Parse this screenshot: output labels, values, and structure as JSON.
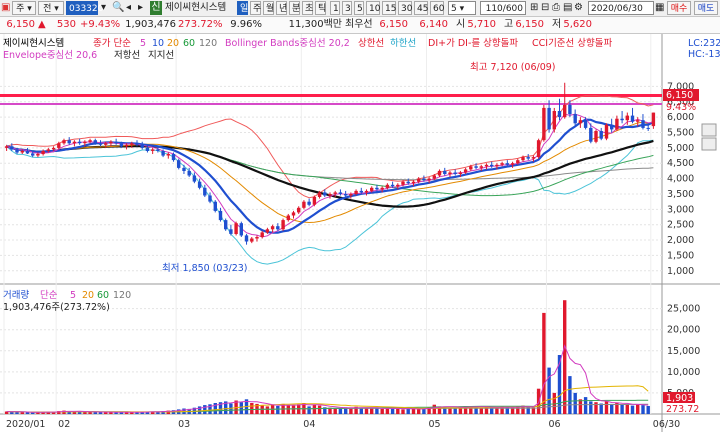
{
  "toolbar": {
    "market_label": "주",
    "market_suffix": "전",
    "code_value": "033320",
    "badge": "신",
    "company_name": "제이씨현시스템",
    "period_tabs": [
      "일",
      "주",
      "월",
      "년",
      "분",
      "초",
      "틱"
    ],
    "selected_period_index": 0,
    "minute_buttons": [
      "1",
      "3",
      "5",
      "10",
      "15",
      "30",
      "45",
      "60"
    ],
    "interval_value": "5",
    "count_value": "110/600",
    "date_value": "2020/06/30",
    "buy_label": "매수",
    "sell_label": "매도"
  },
  "quote": {
    "price": "6,150",
    "change": "530",
    "change_pct": "+9.43%",
    "volume": "1,903,476",
    "volume_ratio": "273.72%",
    "turnover": "9.96%",
    "value": "11,300백만",
    "best_ask_label": "최우선",
    "best_ask": "6,150",
    "best_bid": "6,140",
    "open_label": "시",
    "open": "5,710",
    "high_label": "고",
    "high": "6,150",
    "low_label": "저",
    "low": "5,620"
  },
  "indicators": {
    "name": "제이씨현시스템",
    "ma_label": "종가 단순",
    "ma_periods": [
      "5",
      "10",
      "20",
      "60",
      "120"
    ],
    "bb_label": "Bollinger Bands중심선 20,2",
    "bb_upper": "상한선",
    "bb_lower": "하한선",
    "dmi_label": "DI+가 DI-를 상향돌파",
    "cci_label": "CCI기준선 상향돌파",
    "env_label": "Envelope중심선 20,6",
    "resist_label": "저항선",
    "support_label": "지지선",
    "lc_label": "LC:232",
    "hc_label": "HC:-13"
  },
  "annotations": {
    "high": "최고 7,120 (06/09)",
    "low": "최저 1,850 (03/23)",
    "last_price": "6,150",
    "last_pct": "9.43%"
  },
  "volume_panel": {
    "title": "거래량",
    "ma_label": "단순",
    "ma_periods": [
      "5",
      "20",
      "60",
      "120"
    ],
    "current": "1,903,476주(273.72%)",
    "last_box": "1,903",
    "last_pct": "273.72"
  },
  "chart_data": {
    "type": "candlestick",
    "price_axis": {
      "ticks": [
        "7,000",
        "6,500",
        "6,000",
        "5,500",
        "5,000",
        "4,500",
        "4,000",
        "3,500",
        "3,000",
        "2,500",
        "2,000",
        "1,500",
        "1,000"
      ],
      "range": [
        700,
        7600
      ]
    },
    "volume_axis": {
      "ticks": [
        "25,000",
        "20,000",
        "15,000",
        "10,000",
        "5,000"
      ],
      "range": [
        0,
        28000
      ],
      "unit": "천주"
    },
    "x_labels": [
      "2020/01",
      "02",
      "03",
      "04",
      "05",
      "06",
      "06/30"
    ],
    "x_label_positions": [
      0,
      10,
      33,
      57,
      81,
      104,
      124
    ],
    "candles": [
      {
        "o": 5000,
        "h": 5100,
        "l": 4900,
        "c": 5050
      },
      {
        "o": 5050,
        "h": 5150,
        "l": 4900,
        "c": 4950
      },
      {
        "o": 4950,
        "h": 5000,
        "l": 4800,
        "c": 4850
      },
      {
        "o": 4850,
        "h": 4950,
        "l": 4800,
        "c": 4900
      },
      {
        "o": 4900,
        "h": 5000,
        "l": 4800,
        "c": 4820
      },
      {
        "o": 4820,
        "h": 4900,
        "l": 4700,
        "c": 4750
      },
      {
        "o": 4750,
        "h": 4850,
        "l": 4700,
        "c": 4800
      },
      {
        "o": 4800,
        "h": 4950,
        "l": 4750,
        "c": 4900
      },
      {
        "o": 4900,
        "h": 5000,
        "l": 4850,
        "c": 4950
      },
      {
        "o": 4950,
        "h": 5050,
        "l": 4900,
        "c": 5000
      },
      {
        "o": 5000,
        "h": 5200,
        "l": 4950,
        "c": 5150
      },
      {
        "o": 5150,
        "h": 5300,
        "l": 5100,
        "c": 5250
      },
      {
        "o": 5250,
        "h": 5350,
        "l": 5100,
        "c": 5150
      },
      {
        "o": 5150,
        "h": 5250,
        "l": 5050,
        "c": 5200
      },
      {
        "o": 5200,
        "h": 5300,
        "l": 5100,
        "c": 5150
      },
      {
        "o": 5150,
        "h": 5250,
        "l": 5050,
        "c": 5200
      },
      {
        "o": 5200,
        "h": 5300,
        "l": 5150,
        "c": 5250
      },
      {
        "o": 5250,
        "h": 5300,
        "l": 5100,
        "c": 5150
      },
      {
        "o": 5150,
        "h": 5250,
        "l": 5050,
        "c": 5100
      },
      {
        "o": 5100,
        "h": 5200,
        "l": 5000,
        "c": 5150
      },
      {
        "o": 5150,
        "h": 5250,
        "l": 5050,
        "c": 5200
      },
      {
        "o": 5200,
        "h": 5300,
        "l": 5100,
        "c": 5150
      },
      {
        "o": 5150,
        "h": 5200,
        "l": 5000,
        "c": 5050
      },
      {
        "o": 5050,
        "h": 5150,
        "l": 4950,
        "c": 5100
      },
      {
        "o": 5100,
        "h": 5200,
        "l": 5000,
        "c": 5150
      },
      {
        "o": 5150,
        "h": 5250,
        "l": 5050,
        "c": 5100
      },
      {
        "o": 5100,
        "h": 5200,
        "l": 4950,
        "c": 5000
      },
      {
        "o": 5000,
        "h": 5100,
        "l": 4850,
        "c": 4900
      },
      {
        "o": 4900,
        "h": 5000,
        "l": 4800,
        "c": 4950
      },
      {
        "o": 4950,
        "h": 5050,
        "l": 4850,
        "c": 4900
      },
      {
        "o": 4900,
        "h": 4950,
        "l": 4700,
        "c": 4750
      },
      {
        "o": 4750,
        "h": 4850,
        "l": 4650,
        "c": 4800
      },
      {
        "o": 4800,
        "h": 4850,
        "l": 4550,
        "c": 4600
      },
      {
        "o": 4600,
        "h": 4650,
        "l": 4300,
        "c": 4350
      },
      {
        "o": 4350,
        "h": 4450,
        "l": 4150,
        "c": 4250
      },
      {
        "o": 4250,
        "h": 4350,
        "l": 4050,
        "c": 4100
      },
      {
        "o": 4100,
        "h": 4200,
        "l": 3850,
        "c": 3900
      },
      {
        "o": 3900,
        "h": 4000,
        "l": 3650,
        "c": 3700
      },
      {
        "o": 3700,
        "h": 3800,
        "l": 3400,
        "c": 3450
      },
      {
        "o": 3450,
        "h": 3550,
        "l": 3200,
        "c": 3250
      },
      {
        "o": 3250,
        "h": 3300,
        "l": 2900,
        "c": 2950
      },
      {
        "o": 2950,
        "h": 3050,
        "l": 2600,
        "c": 2650
      },
      {
        "o": 2650,
        "h": 2700,
        "l": 2300,
        "c": 2350
      },
      {
        "o": 2350,
        "h": 2500,
        "l": 2150,
        "c": 2200
      },
      {
        "o": 2200,
        "h": 2600,
        "l": 2150,
        "c": 2550
      },
      {
        "o": 2550,
        "h": 2600,
        "l": 2100,
        "c": 2150
      },
      {
        "o": 2150,
        "h": 2200,
        "l": 1850,
        "c": 1950
      },
      {
        "o": 1950,
        "h": 2100,
        "l": 1900,
        "c": 2050
      },
      {
        "o": 2050,
        "h": 2150,
        "l": 1950,
        "c": 2100
      },
      {
        "o": 2100,
        "h": 2300,
        "l": 2050,
        "c": 2250
      },
      {
        "o": 2250,
        "h": 2400,
        "l": 2200,
        "c": 2350
      },
      {
        "o": 2350,
        "h": 2500,
        "l": 2250,
        "c": 2450
      },
      {
        "o": 2450,
        "h": 2550,
        "l": 2300,
        "c": 2350
      },
      {
        "o": 2350,
        "h": 2700,
        "l": 2300,
        "c": 2650
      },
      {
        "o": 2650,
        "h": 2850,
        "l": 2600,
        "c": 2800
      },
      {
        "o": 2800,
        "h": 2950,
        "l": 2700,
        "c": 2900
      },
      {
        "o": 2900,
        "h": 3100,
        "l": 2850,
        "c": 3050
      },
      {
        "o": 3050,
        "h": 3300,
        "l": 3000,
        "c": 3250
      },
      {
        "o": 3250,
        "h": 3350,
        "l": 3100,
        "c": 3150
      },
      {
        "o": 3150,
        "h": 3450,
        "l": 3100,
        "c": 3400
      },
      {
        "o": 3400,
        "h": 3600,
        "l": 3350,
        "c": 3550
      },
      {
        "o": 3550,
        "h": 3650,
        "l": 3400,
        "c": 3450
      },
      {
        "o": 3450,
        "h": 3550,
        "l": 3350,
        "c": 3500
      },
      {
        "o": 3500,
        "h": 3600,
        "l": 3400,
        "c": 3550
      },
      {
        "o": 3550,
        "h": 3650,
        "l": 3450,
        "c": 3500
      },
      {
        "o": 3500,
        "h": 3600,
        "l": 3400,
        "c": 3450
      },
      {
        "o": 3450,
        "h": 3550,
        "l": 3350,
        "c": 3500
      },
      {
        "o": 3500,
        "h": 3650,
        "l": 3450,
        "c": 3600
      },
      {
        "o": 3600,
        "h": 3700,
        "l": 3500,
        "c": 3550
      },
      {
        "o": 3550,
        "h": 3650,
        "l": 3450,
        "c": 3600
      },
      {
        "o": 3600,
        "h": 3750,
        "l": 3550,
        "c": 3700
      },
      {
        "o": 3700,
        "h": 3800,
        "l": 3600,
        "c": 3650
      },
      {
        "o": 3650,
        "h": 3750,
        "l": 3550,
        "c": 3700
      },
      {
        "o": 3700,
        "h": 3850,
        "l": 3650,
        "c": 3800
      },
      {
        "o": 3800,
        "h": 3900,
        "l": 3700,
        "c": 3750
      },
      {
        "o": 3750,
        "h": 3850,
        "l": 3650,
        "c": 3800
      },
      {
        "o": 3800,
        "h": 3950,
        "l": 3750,
        "c": 3900
      },
      {
        "o": 3900,
        "h": 4000,
        "l": 3800,
        "c": 3850
      },
      {
        "o": 3850,
        "h": 3950,
        "l": 3750,
        "c": 3900
      },
      {
        "o": 3900,
        "h": 4050,
        "l": 3850,
        "c": 4000
      },
      {
        "o": 4000,
        "h": 4100,
        "l": 3900,
        "c": 3950
      },
      {
        "o": 3950,
        "h": 4050,
        "l": 3850,
        "c": 4000
      },
      {
        "o": 4000,
        "h": 4150,
        "l": 3950,
        "c": 4100
      },
      {
        "o": 4100,
        "h": 4300,
        "l": 4050,
        "c": 4250
      },
      {
        "o": 4250,
        "h": 4350,
        "l": 4100,
        "c": 4150
      },
      {
        "o": 4150,
        "h": 4250,
        "l": 4050,
        "c": 4200
      },
      {
        "o": 4200,
        "h": 4300,
        "l": 4100,
        "c": 4150
      },
      {
        "o": 4150,
        "h": 4250,
        "l": 4050,
        "c": 4200
      },
      {
        "o": 4200,
        "h": 4350,
        "l": 4150,
        "c": 4300
      },
      {
        "o": 4300,
        "h": 4450,
        "l": 4250,
        "c": 4400
      },
      {
        "o": 4400,
        "h": 4500,
        "l": 4300,
        "c": 4350
      },
      {
        "o": 4350,
        "h": 4450,
        "l": 4250,
        "c": 4400
      },
      {
        "o": 4400,
        "h": 4500,
        "l": 4300,
        "c": 4450
      },
      {
        "o": 4450,
        "h": 4550,
        "l": 4350,
        "c": 4400
      },
      {
        "o": 4400,
        "h": 4500,
        "l": 4300,
        "c": 4450
      },
      {
        "o": 4450,
        "h": 4550,
        "l": 4400,
        "c": 4500
      },
      {
        "o": 4500,
        "h": 4600,
        "l": 4400,
        "c": 4450
      },
      {
        "o": 4450,
        "h": 4550,
        "l": 4350,
        "c": 4500
      },
      {
        "o": 4500,
        "h": 4650,
        "l": 4450,
        "c": 4600
      },
      {
        "o": 4600,
        "h": 4750,
        "l": 4550,
        "c": 4700
      },
      {
        "o": 4700,
        "h": 4800,
        "l": 4600,
        "c": 4650
      },
      {
        "o": 4650,
        "h": 4750,
        "l": 4550,
        "c": 4700
      },
      {
        "o": 4700,
        "h": 5300,
        "l": 4650,
        "c": 5250
      },
      {
        "o": 5250,
        "h": 6400,
        "l": 5200,
        "c": 6300
      },
      {
        "o": 6300,
        "h": 6550,
        "l": 5500,
        "c": 5600
      },
      {
        "o": 5600,
        "h": 6300,
        "l": 5500,
        "c": 6200
      },
      {
        "o": 6200,
        "h": 6600,
        "l": 5900,
        "c": 6000
      },
      {
        "o": 6000,
        "h": 7120,
        "l": 5950,
        "c": 6400
      },
      {
        "o": 6400,
        "h": 6550,
        "l": 6000,
        "c": 6100
      },
      {
        "o": 6100,
        "h": 6250,
        "l": 5700,
        "c": 5800
      },
      {
        "o": 5800,
        "h": 6000,
        "l": 5650,
        "c": 5900
      },
      {
        "o": 5900,
        "h": 6000,
        "l": 5600,
        "c": 5650
      },
      {
        "o": 5650,
        "h": 5800,
        "l": 5150,
        "c": 5200
      },
      {
        "o": 5200,
        "h": 5600,
        "l": 5150,
        "c": 5550
      },
      {
        "o": 5550,
        "h": 5650,
        "l": 5250,
        "c": 5300
      },
      {
        "o": 5300,
        "h": 5800,
        "l": 5250,
        "c": 5750
      },
      {
        "o": 5750,
        "h": 5950,
        "l": 5500,
        "c": 5600
      },
      {
        "o": 5600,
        "h": 6050,
        "l": 5550,
        "c": 5950
      },
      {
        "o": 5950,
        "h": 6200,
        "l": 5800,
        "c": 5900
      },
      {
        "o": 5900,
        "h": 6150,
        "l": 5750,
        "c": 6050
      },
      {
        "o": 6050,
        "h": 6300,
        "l": 5800,
        "c": 5850
      },
      {
        "o": 5850,
        "h": 6000,
        "l": 5700,
        "c": 5900
      },
      {
        "o": 5900,
        "h": 6100,
        "l": 5600,
        "c": 5650
      },
      {
        "o": 5650,
        "h": 5800,
        "l": 5550,
        "c": 5620
      },
      {
        "o": 5710,
        "h": 6150,
        "l": 5620,
        "c": 6150
      }
    ],
    "volumes": [
      600,
      500,
      450,
      400,
      380,
      420,
      400,
      520,
      480,
      450,
      700,
      800,
      600,
      550,
      500,
      520,
      480,
      450,
      400,
      430,
      450,
      420,
      380,
      400,
      420,
      400,
      480,
      600,
      550,
      520,
      700,
      800,
      900,
      1100,
      1300,
      1200,
      1500,
      1800,
      2100,
      2300,
      2600,
      2800,
      3000,
      2500,
      3200,
      2800,
      3500,
      2600,
      2400,
      2000,
      1800,
      2200,
      1900,
      2400,
      2100,
      2000,
      2300,
      2600,
      1800,
      2200,
      2000,
      1600,
      1500,
      1400,
      1300,
      1600,
      1500,
      1700,
      1400,
      1300,
      1500,
      1400,
      1200,
      1300,
      1500,
      1200,
      1100,
      1300,
      1200,
      1100,
      1400,
      1600,
      2200,
      1800,
      1600,
      1500,
      1400,
      1700,
      1900,
      1800,
      1600,
      1500,
      1700,
      1600,
      1500,
      1700,
      1600,
      1500,
      1800,
      2000,
      1700,
      1600,
      6000,
      24000,
      11000,
      5000,
      14000,
      27000,
      9000,
      5000,
      3500,
      4000,
      3000,
      2800,
      2500,
      3000,
      2400,
      2600,
      2200,
      2400,
      2000,
      2200,
      2100,
      1900
    ]
  }
}
